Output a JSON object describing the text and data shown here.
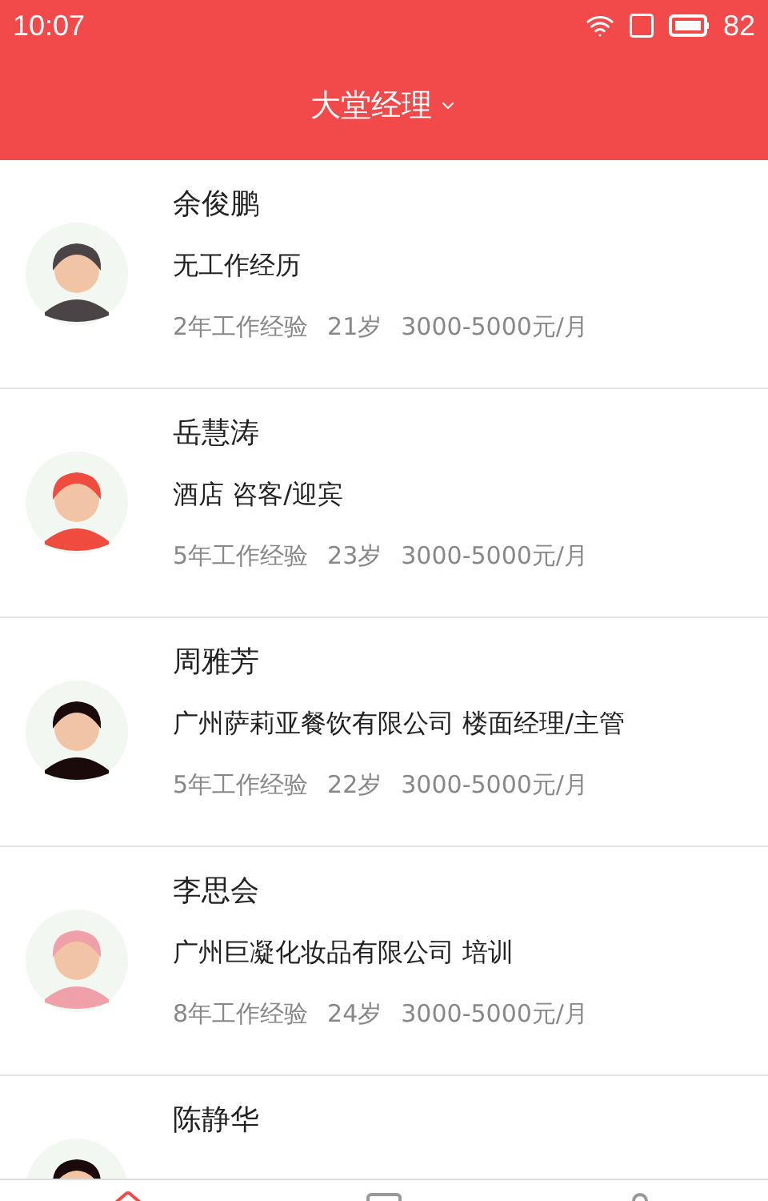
{
  "status_bar": {
    "time": "10:07",
    "battery": "82"
  },
  "header": {
    "title": "大堂经理"
  },
  "candidates": [
    {
      "name": "余俊鹏",
      "experience": "无工作经历",
      "years": "2年工作经验",
      "age": "21岁",
      "salary": "3000-5000元/月",
      "color": "#4a4446"
    },
    {
      "name": "岳慧涛",
      "experience": "酒店 咨客/迎宾",
      "years": "5年工作经验",
      "age": "23岁",
      "salary": "3000-5000元/月",
      "color": "#ef4b3e"
    },
    {
      "name": "周雅芳",
      "experience": "广州萨莉亚餐饮有限公司 楼面经理/主管",
      "years": "5年工作经验",
      "age": "22岁",
      "salary": "3000-5000元/月",
      "color": "#1a0a0a"
    },
    {
      "name": "李思会",
      "experience": "广州巨凝化妆品有限公司 培训",
      "years": "8年工作经验",
      "age": "24岁",
      "salary": "3000-5000元/月",
      "color": "#f0a0a8"
    },
    {
      "name": "陈静华",
      "color": "#1a0a0a"
    }
  ]
}
